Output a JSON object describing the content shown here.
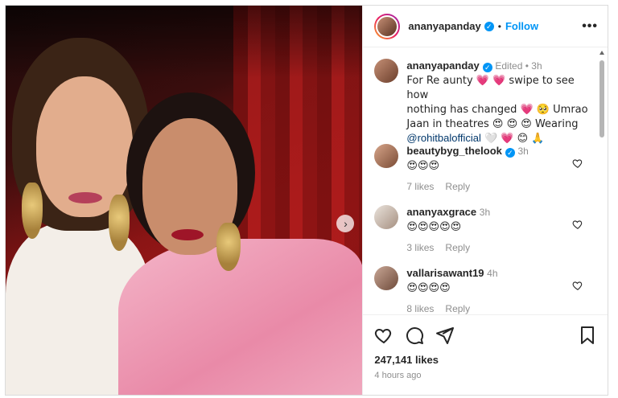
{
  "post": {
    "username": "ananyapanday",
    "follow_label": "Follow",
    "more_label": "•••"
  },
  "caption": {
    "username": "ananyapanday",
    "edited": "Edited",
    "time": "3h",
    "line1": "For Re aunty 💗 💗 swipe to see how",
    "line2": "nothing has changed 💗 🥺  Umrao",
    "line3": "Jaan in theatres 😍 😍 😍  Wearing",
    "mention": "@rohitbalofficial",
    "line4_rest": " 🤍 💗 😊 🙏"
  },
  "comments": [
    {
      "username": "beautybyg_thelook",
      "verified": true,
      "time": "3h",
      "text": "😍😍😍",
      "likes": "7 likes",
      "reply": "Reply"
    },
    {
      "username": "ananyaxgrace",
      "verified": false,
      "time": "3h",
      "text": "😍😍😍😍😍",
      "likes": "3 likes",
      "reply": "Reply"
    },
    {
      "username": "vallarisawant19",
      "verified": false,
      "time": "4h",
      "text": "😍😍😍😍",
      "likes": "8 likes",
      "reply": "Reply"
    }
  ],
  "footer": {
    "likes": "247,141 likes",
    "time": "4 hours ago"
  },
  "icons": {
    "like": "heart-icon",
    "comment": "comment-icon",
    "share": "share-icon",
    "save": "bookmark-icon",
    "next": "chevron-right-icon"
  },
  "colors": {
    "accent": "#0095f6",
    "muted": "#8e8e8e",
    "mention": "#00376b"
  }
}
